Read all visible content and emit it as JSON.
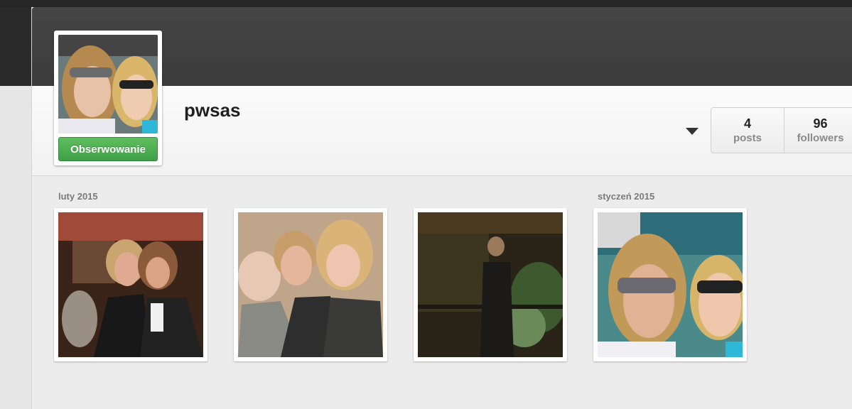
{
  "profile": {
    "username": "pwsas",
    "follow_label": "Obserwowanie"
  },
  "stats": [
    {
      "value": "4",
      "label": "posts"
    },
    {
      "value": "96",
      "label": "followers"
    }
  ],
  "months": [
    {
      "label": "luty 2015"
    },
    {
      "label": "styczeń 2015"
    }
  ],
  "colors": {
    "follow_green": "#4caf50",
    "cover": "#404040"
  }
}
